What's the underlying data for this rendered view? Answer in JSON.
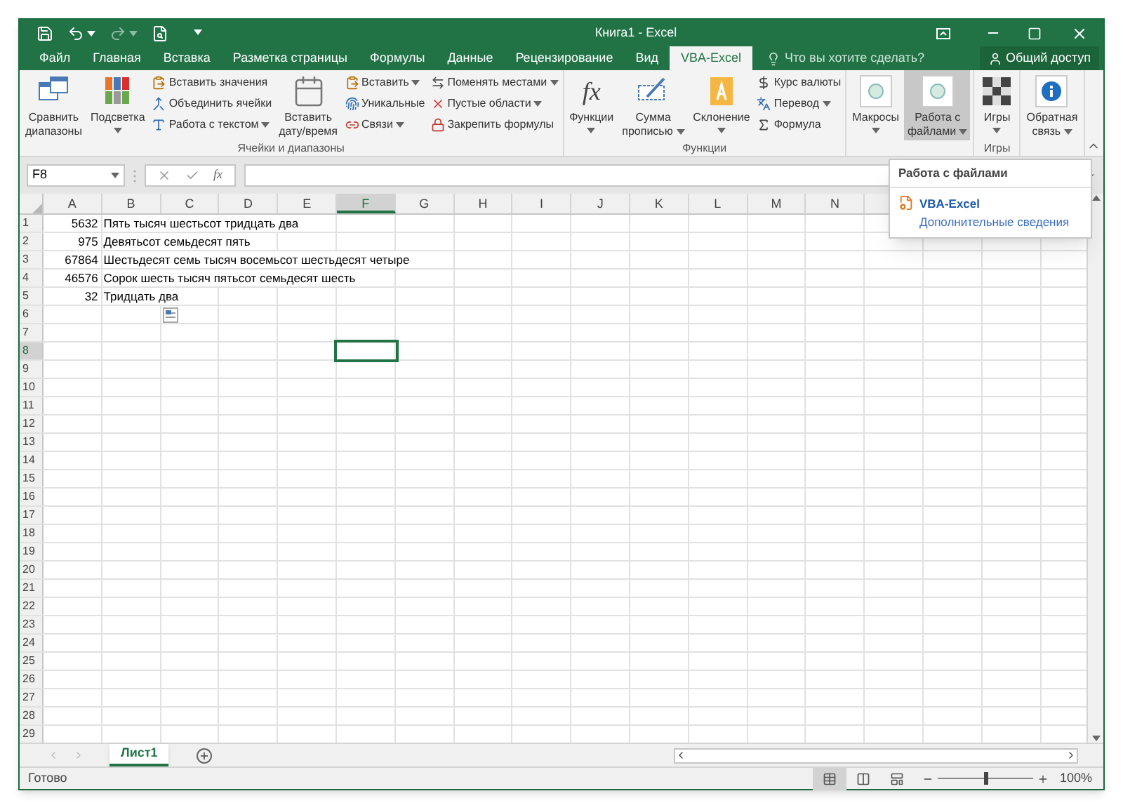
{
  "window": {
    "title": "Книга1 - Excel"
  },
  "tabs": [
    {
      "label": "Файл",
      "selected": false
    },
    {
      "label": "Главная",
      "selected": false
    },
    {
      "label": "Вставка",
      "selected": false
    },
    {
      "label": "Разметка страницы",
      "selected": false
    },
    {
      "label": "Формулы",
      "selected": false
    },
    {
      "label": "Данные",
      "selected": false
    },
    {
      "label": "Рецензирование",
      "selected": false
    },
    {
      "label": "Вид",
      "selected": false
    },
    {
      "label": "VBA-Excel",
      "selected": true
    }
  ],
  "tell_me": {
    "placeholder": "Что вы хотите сделать?"
  },
  "share": "Общий доступ",
  "ribbon": {
    "groups": [
      {
        "label": "Ячейки и диапазоны",
        "items": [
          {
            "kind": "large",
            "lines": [
              "Сравнить",
              "диапазоны"
            ],
            "dropdown": false,
            "selected": false
          },
          {
            "kind": "large",
            "lines": [
              "Подсветка"
            ],
            "dropdown": true,
            "selected": false
          },
          {
            "kind": "stack",
            "items": [
              {
                "label": "Вставить значения",
                "dropdown": false
              },
              {
                "label": "Объединить ячейки",
                "dropdown": false
              },
              {
                "label": "Работа с текстом",
                "dropdown": true
              }
            ]
          },
          {
            "kind": "large",
            "lines": [
              "Вставить",
              "дату/время"
            ],
            "dropdown": false,
            "selected": false
          },
          {
            "kind": "stack",
            "items": [
              {
                "label": "Вставить",
                "dropdown": true
              },
              {
                "label": "Уникальные",
                "dropdown": false
              },
              {
                "label": "Связи",
                "dropdown": true
              }
            ]
          },
          {
            "kind": "stack",
            "items": [
              {
                "label": "Поменять местами",
                "dropdown": true
              },
              {
                "label": "Пустые области",
                "dropdown": true
              },
              {
                "label": "Закрепить формулы",
                "dropdown": false
              }
            ]
          }
        ]
      },
      {
        "label": "Функции",
        "items": [
          {
            "kind": "large",
            "symbol": "fx",
            "lines": [
              "Функции"
            ],
            "dropdown": true,
            "selected": false
          },
          {
            "kind": "large",
            "lines": [
              "Сумма",
              "прописью"
            ],
            "dropdown": true,
            "selected": false
          },
          {
            "kind": "large",
            "lines": [
              "Склонение"
            ],
            "dropdown": true,
            "selected": false
          },
          {
            "kind": "stack",
            "items": [
              {
                "label": "Курс валюты",
                "dropdown": false
              },
              {
                "label": "Перевод",
                "dropdown": true
              },
              {
                "label": "Формула",
                "dropdown": false
              }
            ]
          }
        ]
      },
      {
        "items": [
          {
            "kind": "large",
            "lines": [
              "Макросы"
            ],
            "dropdown": true,
            "selected": false
          },
          {
            "kind": "large",
            "lines": [
              "Работа с",
              "файлами"
            ],
            "dropdown": true,
            "selected": true
          }
        ]
      },
      {
        "label": "Игры",
        "items": [
          {
            "kind": "large",
            "lines": [
              "Игры"
            ],
            "dropdown": true,
            "selected": false
          }
        ]
      },
      {
        "items": [
          {
            "kind": "large",
            "lines": [
              "Обратная",
              "связь"
            ],
            "dropdown": true,
            "selected": false
          }
        ]
      }
    ]
  },
  "formula_bar": {
    "name_box": "F8",
    "fx": "fx"
  },
  "sheet": {
    "columns": [
      {
        "label": "A",
        "selected": false
      },
      {
        "label": "B",
        "selected": false
      },
      {
        "label": "C",
        "selected": false
      },
      {
        "label": "D",
        "selected": false
      },
      {
        "label": "E",
        "selected": false
      },
      {
        "label": "F",
        "selected": true
      },
      {
        "label": "G",
        "selected": false
      },
      {
        "label": "H",
        "selected": false
      },
      {
        "label": "I",
        "selected": false
      },
      {
        "label": "J",
        "selected": false
      },
      {
        "label": "K",
        "selected": false
      },
      {
        "label": "L",
        "selected": false
      },
      {
        "label": "M",
        "selected": false
      },
      {
        "label": "N",
        "selected": false
      }
    ],
    "rows": [
      {
        "number": "1",
        "selected": false,
        "cells": [
          "5632",
          "Пять тысяч шестьсот тридцать два"
        ]
      },
      {
        "number": "2",
        "selected": false,
        "cells": [
          "975",
          "Девятьсот семьдесят пять"
        ]
      },
      {
        "number": "3",
        "selected": false,
        "cells": [
          "67864",
          "Шестьдесят семь тысяч восемьсот шестьдесят четыре"
        ]
      },
      {
        "number": "4",
        "selected": false,
        "cells": [
          "46576",
          "Сорок шесть тысяч пятьсот семьдесят шесть"
        ]
      },
      {
        "number": "5",
        "selected": false,
        "cells": [
          "32",
          "Тридцать два"
        ]
      },
      {
        "number": "6",
        "selected": false,
        "paste_options": true
      },
      {
        "number": "7",
        "selected": false
      },
      {
        "number": "8",
        "selected": true
      },
      {
        "number": "9",
        "selected": false
      },
      {
        "number": "10",
        "selected": false
      },
      {
        "number": "11",
        "selected": false
      },
      {
        "number": "12",
        "selected": false
      },
      {
        "number": "13",
        "selected": false
      },
      {
        "number": "14",
        "selected": false
      },
      {
        "number": "15",
        "selected": false
      },
      {
        "number": "16",
        "selected": false
      },
      {
        "number": "17",
        "selected": false
      },
      {
        "number": "18",
        "selected": false
      },
      {
        "number": "19",
        "selected": false
      },
      {
        "number": "20",
        "selected": false
      },
      {
        "number": "21",
        "selected": false
      },
      {
        "number": "22",
        "selected": false
      },
      {
        "number": "23",
        "selected": false
      },
      {
        "number": "24",
        "selected": false
      },
      {
        "number": "25",
        "selected": false
      },
      {
        "number": "26",
        "selected": false
      },
      {
        "number": "27",
        "selected": false
      },
      {
        "number": "28",
        "selected": false
      },
      {
        "number": "29",
        "selected": false
      }
    ]
  },
  "sheet_tabs": [
    {
      "label": "Лист1",
      "selected": true
    }
  ],
  "dropdown": {
    "header": "Работа с файлами",
    "items": [
      {
        "label": "VBA-Excel",
        "details": "Дополнительные сведения"
      }
    ]
  },
  "status_bar": {
    "status": "Готово",
    "zoom": {
      "level": 0.5,
      "reading": "100%"
    }
  }
}
